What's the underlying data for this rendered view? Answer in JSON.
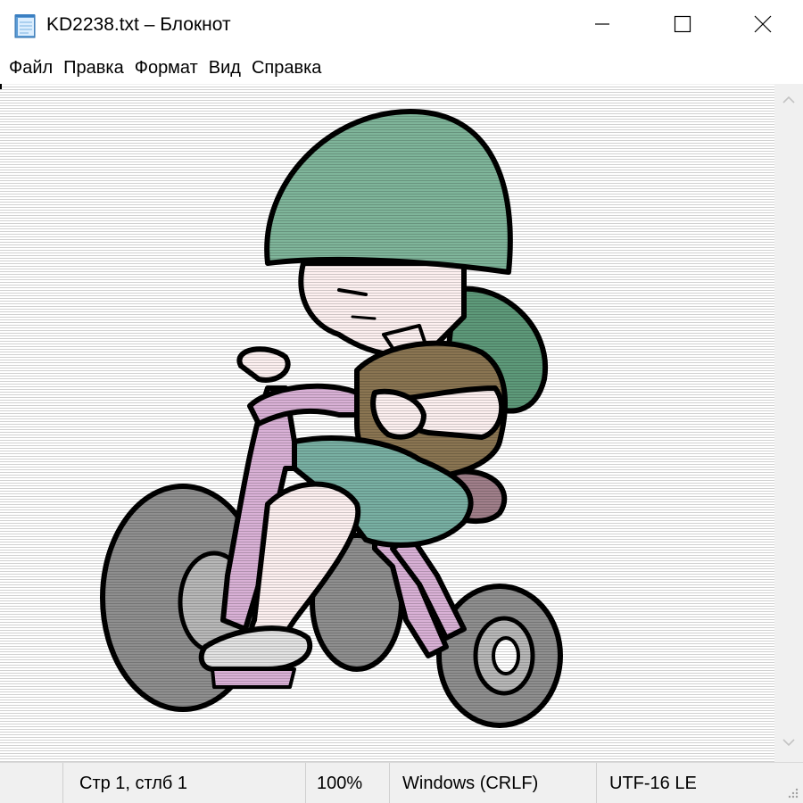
{
  "window": {
    "title": "KD2238.txt – Блокнот",
    "app_icon": "notepad-icon",
    "controls": [
      "minimize-icon",
      "maximize-icon",
      "close-icon"
    ]
  },
  "menu": {
    "items": [
      "Файл",
      "Правка",
      "Формат",
      "Вид",
      "Справка"
    ]
  },
  "document": {
    "content_description_type": "ascii-art-image",
    "colors": {
      "helmet": "#7fb59a",
      "helmet_back": "#5e9a7a",
      "skin": "#fdf0f0",
      "shirt": "#8a7552",
      "shorts": "#79b0a3",
      "bike_frame": "#d9b1d6",
      "wheel_tire": "#8f8f8f",
      "wheel_hub": "#b8b8b8",
      "shoe": "#e3e3e3",
      "seat": "#a07f8a",
      "outline": "#000000"
    }
  },
  "scrollbar": {
    "up_icon": "chevron-up-icon",
    "down_icon": "chevron-down-icon"
  },
  "status": {
    "position": "Стр 1, стлб 1",
    "zoom": "100%",
    "line_endings": "Windows (CRLF)",
    "encoding": "UTF-16 LE"
  }
}
